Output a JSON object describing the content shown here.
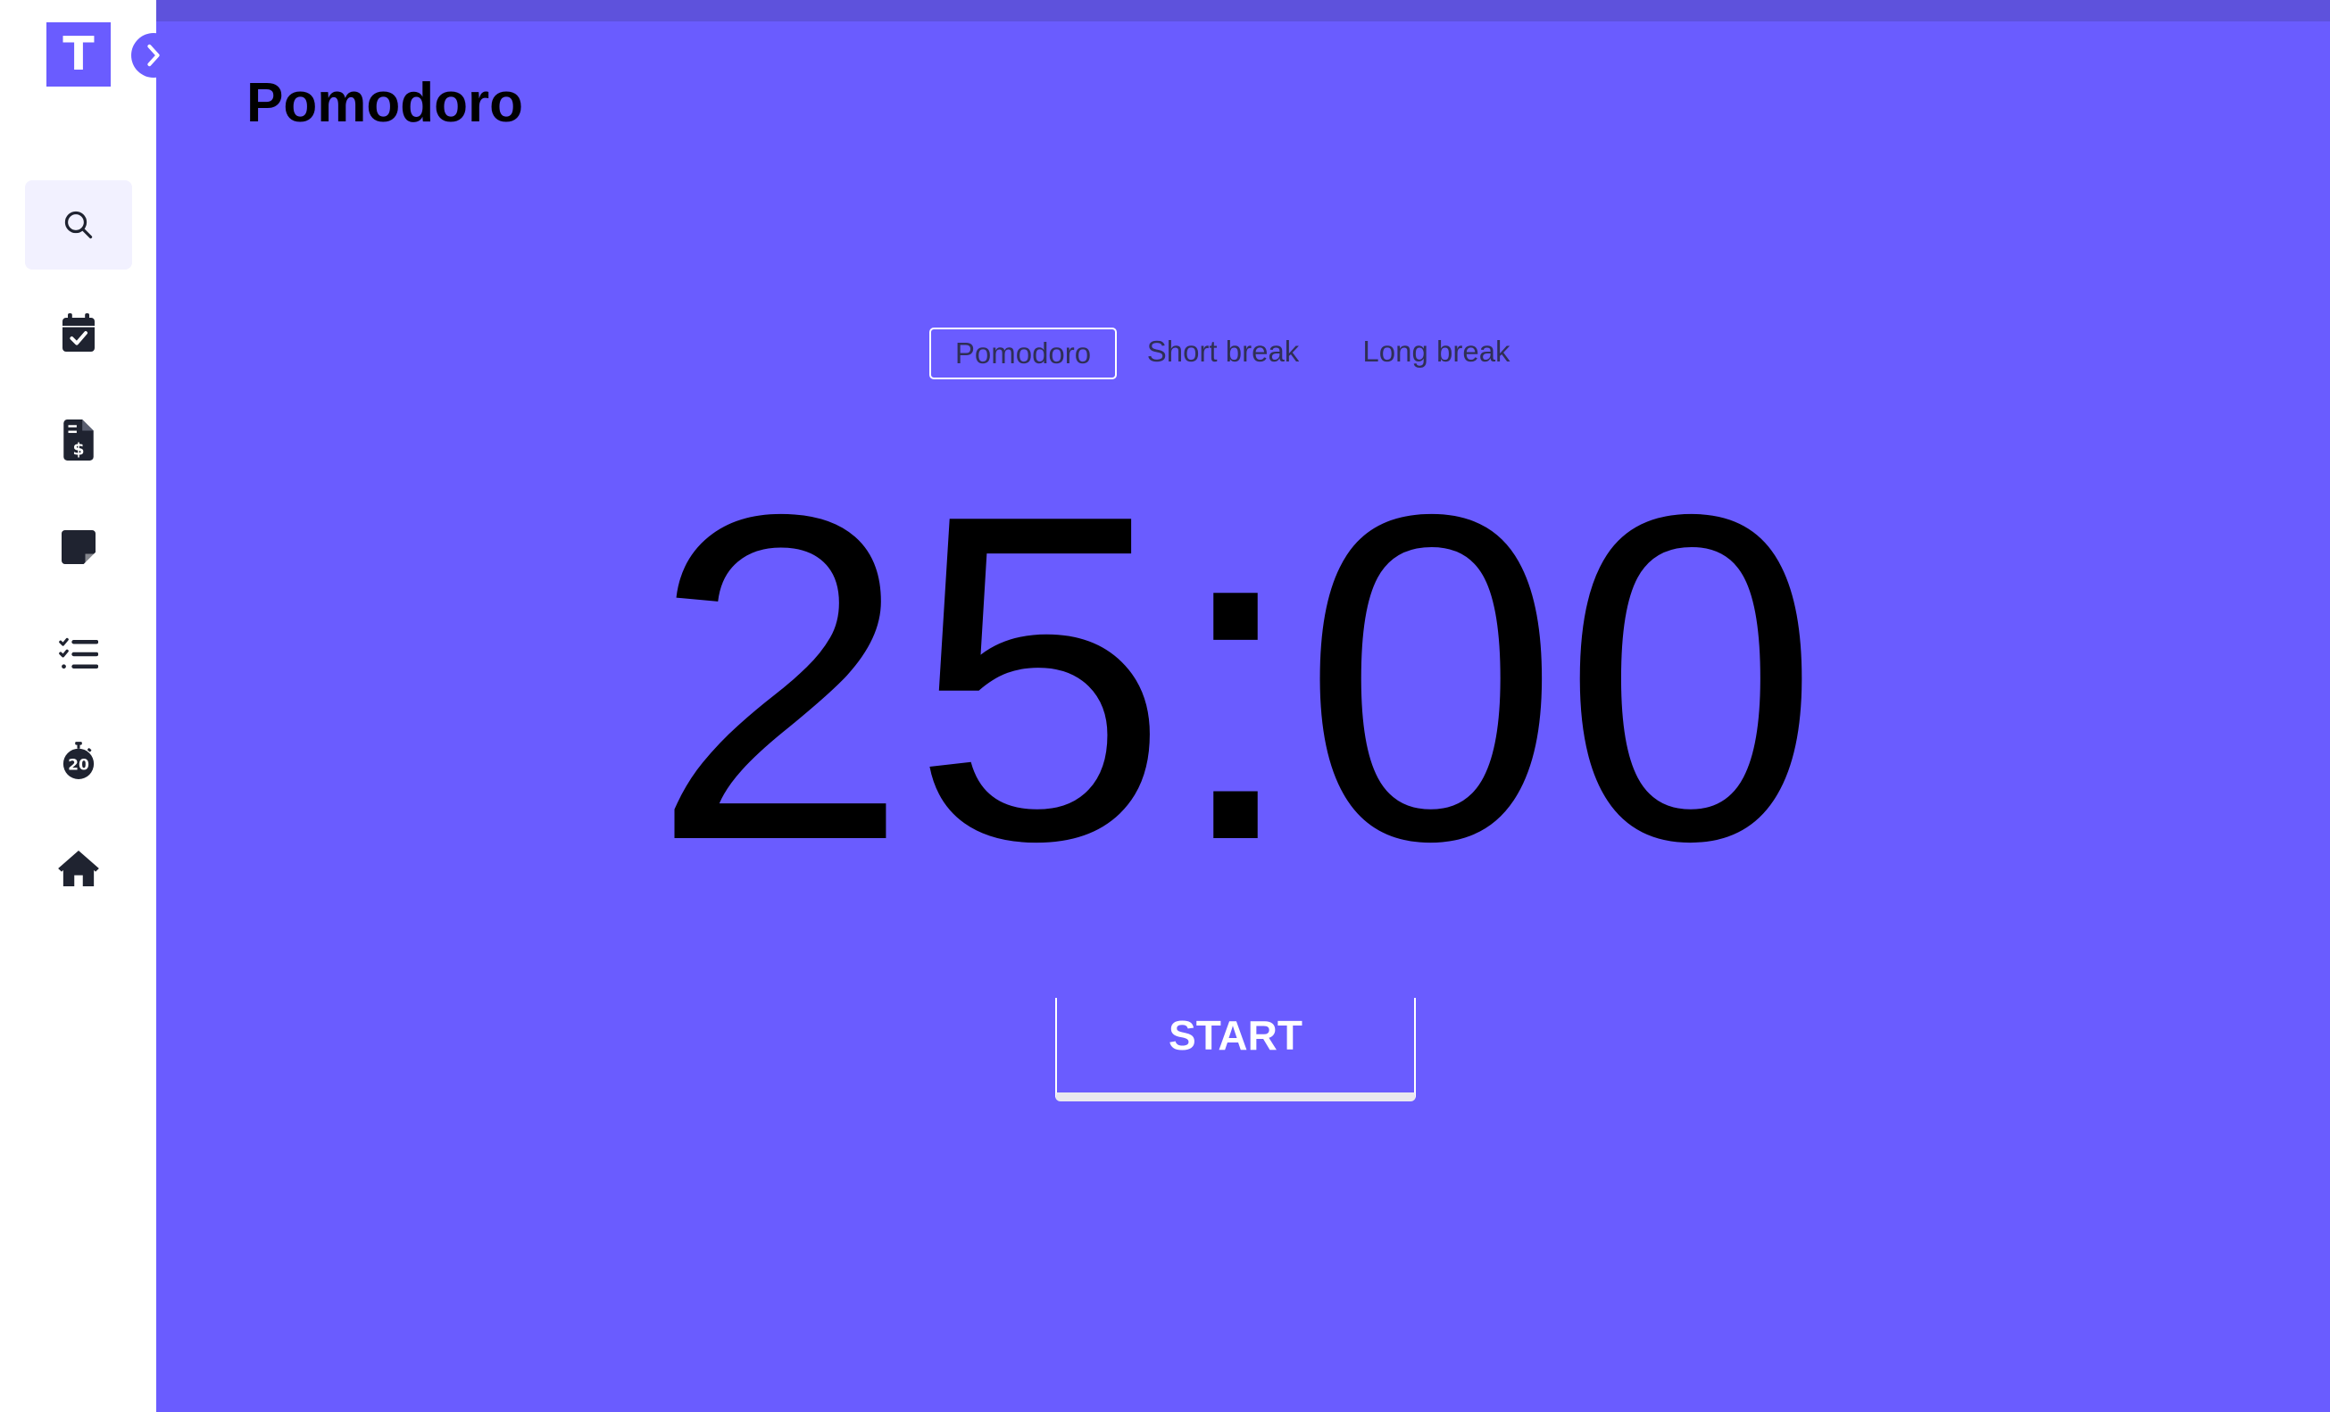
{
  "brand": {
    "logo_letter": "T",
    "accent_color": "#6a5cff",
    "topbar_color": "#5e52dc"
  },
  "sidebar": {
    "toggle_icon": "chevron-right-icon",
    "items": [
      {
        "icon": "search-icon",
        "active": true
      },
      {
        "icon": "calendar-check-icon",
        "active": false
      },
      {
        "icon": "invoice-dollar-icon",
        "active": false
      },
      {
        "icon": "sticky-note-icon",
        "active": false
      },
      {
        "icon": "checklist-icon",
        "active": false
      },
      {
        "icon": "stopwatch-20-icon",
        "active": false,
        "label": "20"
      },
      {
        "icon": "home-icon",
        "active": false
      }
    ]
  },
  "main": {
    "title": "Pomodoro",
    "tabs": [
      {
        "label": "Pomodoro",
        "selected": true
      },
      {
        "label": "Short break",
        "selected": false
      },
      {
        "label": "Long break",
        "selected": false
      }
    ],
    "timer": "25:00",
    "start_label": "START"
  }
}
